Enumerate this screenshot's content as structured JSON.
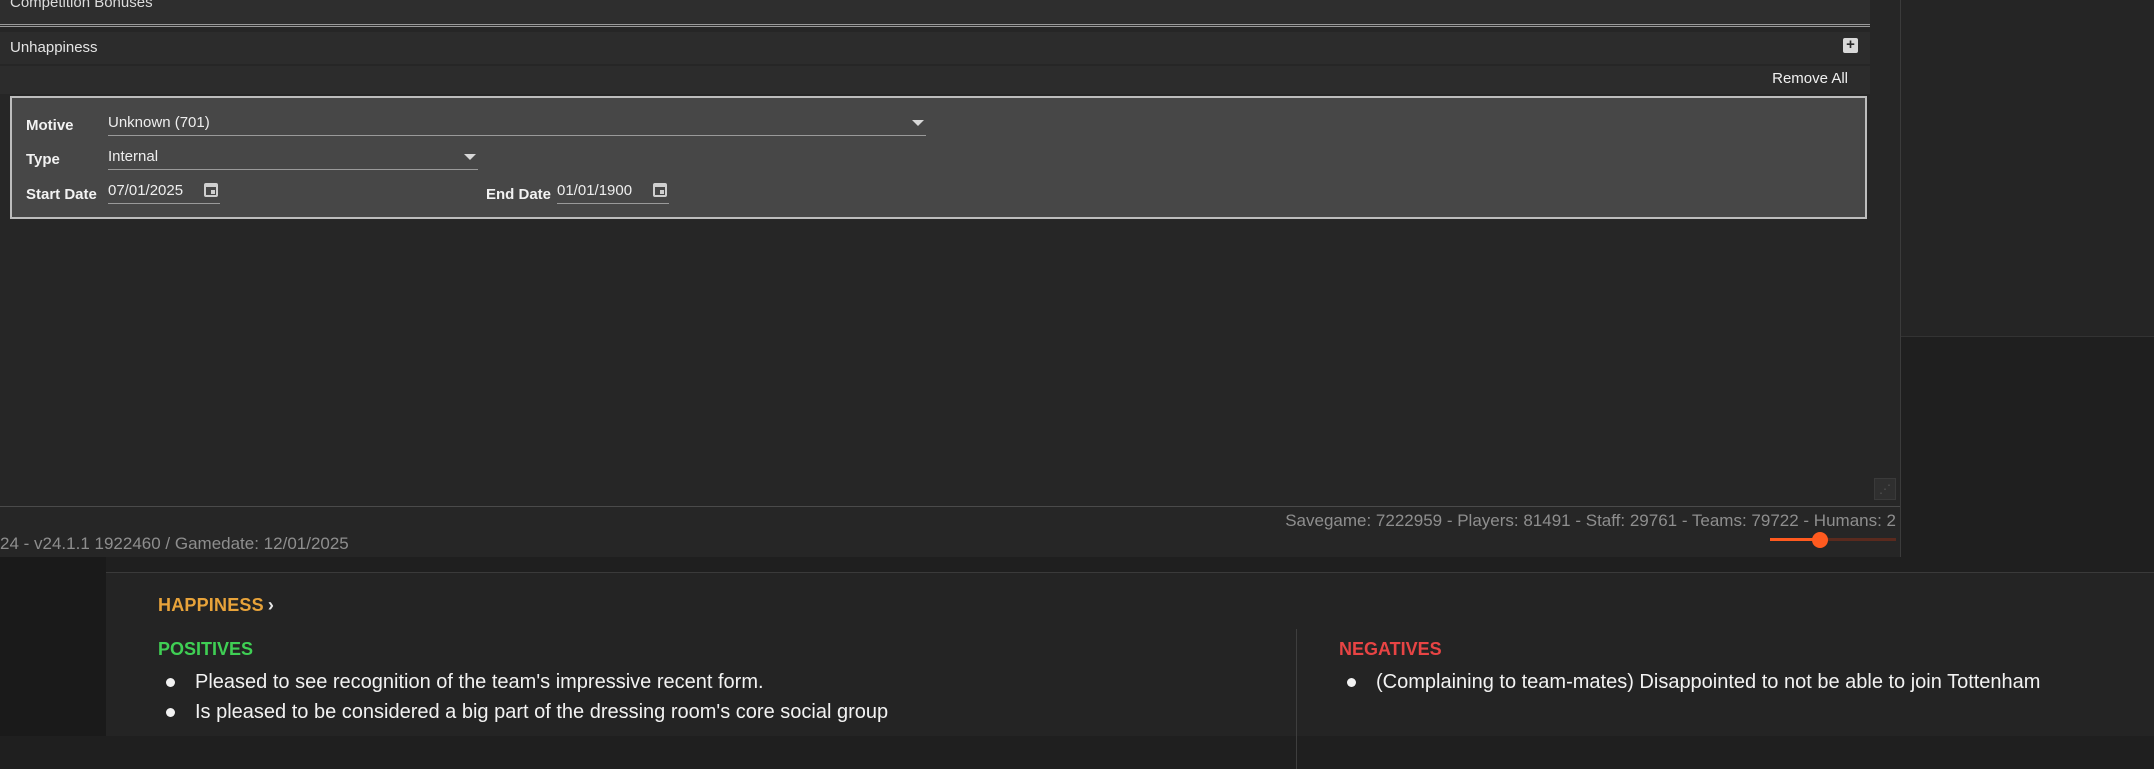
{
  "editor": {
    "competition_bonuses_label": "Competition Bonuses",
    "unhappiness_label": "Unhappiness",
    "add_icon": "plus-square-icon",
    "remove_all_label": "Remove All",
    "entry": {
      "motive_label": "Motive",
      "motive_value": "Unknown (701)",
      "type_label": "Type",
      "type_value": "Internal",
      "start_date_label": "Start Date",
      "start_date_value": "07/01/2025",
      "end_date_label": "End Date",
      "end_date_value": "01/01/1900"
    }
  },
  "status_bar": {
    "stats_text": "Savegame: 7222959 - Players: 81491 - Staff: 29761 - Teams: 79722 - Humans: 2",
    "version_text": "24 - v24.1.1 1922460 / Gamedate: 12/01/2025",
    "zoom_fraction": 0.4
  },
  "happiness": {
    "title": "HAPPINESS",
    "positives_title": "POSITIVES",
    "negatives_title": "NEGATIVES",
    "positives": [
      "Pleased to see recognition of the team's impressive recent form.",
      "Is pleased to be considered a big part of the dressing room's core social group"
    ],
    "negatives": [
      "(Complaining to team-mates) Disappointed to not be able to join Tottenham"
    ]
  },
  "colors": {
    "happiness_title": "#e8a33a",
    "positives": "#3fcf54",
    "negatives": "#e84444",
    "accent": "#ff5a1f"
  }
}
